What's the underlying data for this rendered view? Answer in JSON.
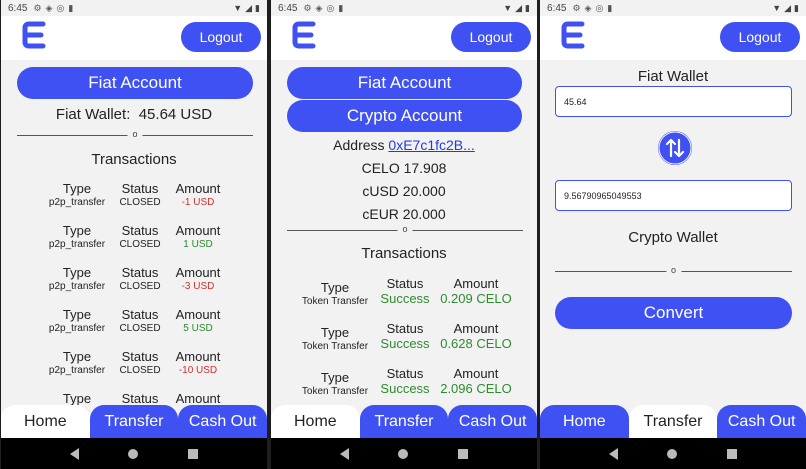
{
  "status": {
    "time": "6:45"
  },
  "header": {
    "logout_label": "Logout"
  },
  "screen1": {
    "fiat_account_label": "Fiat Account",
    "wallet_label": "Fiat Wallet:",
    "wallet_value": "45.64 USD",
    "transactions_title": "Transactions",
    "col_type": "Type",
    "col_status": "Status",
    "col_amount": "Amount",
    "rows": [
      {
        "type": "p2p_transfer",
        "status": "CLOSED",
        "amount": "-1 USD",
        "sign": "neg"
      },
      {
        "type": "p2p_transfer",
        "status": "CLOSED",
        "amount": "1 USD",
        "sign": "pos"
      },
      {
        "type": "p2p_transfer",
        "status": "CLOSED",
        "amount": "-3 USD",
        "sign": "neg"
      },
      {
        "type": "p2p_transfer",
        "status": "CLOSED",
        "amount": "5 USD",
        "sign": "pos"
      },
      {
        "type": "p2p_transfer",
        "status": "CLOSED",
        "amount": "-10 USD",
        "sign": "neg"
      },
      {
        "type": "",
        "status": "",
        "amount": "",
        "sign": "pos"
      }
    ]
  },
  "screen2": {
    "fiat_account_label": "Fiat Account",
    "crypto_account_label": "Crypto Account",
    "address_label": "Address",
    "address_value": "0xE7c1fc2B...",
    "celo": "CELO 17.908",
    "cusd": "cUSD 20.000",
    "ceur": "cEUR 20.000",
    "transactions_title": "Transactions",
    "col_type": "Type",
    "col_status": "Status",
    "col_amount": "Amount",
    "rows": [
      {
        "type": "Token Transfer",
        "status": "Success",
        "amount": "0.209 CELO"
      },
      {
        "type": "Token Transfer",
        "status": "Success",
        "amount": "0.628 CELO"
      },
      {
        "type": "Token Transfer",
        "status": "Success",
        "amount": "2.096 CELO"
      }
    ]
  },
  "screen3": {
    "fiat_wallet_title": "Fiat Wallet",
    "fiat_value": "45.64",
    "crypto_value": "9.56790965049553",
    "crypto_wallet_title": "Crypto Wallet",
    "convert_label": "Convert"
  },
  "tabs": {
    "home": "Home",
    "transfer": "Transfer",
    "cashout": "Cash Out"
  },
  "divider_mark": "o",
  "colors": {
    "accent": "#3f51f2",
    "negative": "#d32f2f",
    "positive": "#2e8b2e",
    "link": "#1f3ce0"
  }
}
